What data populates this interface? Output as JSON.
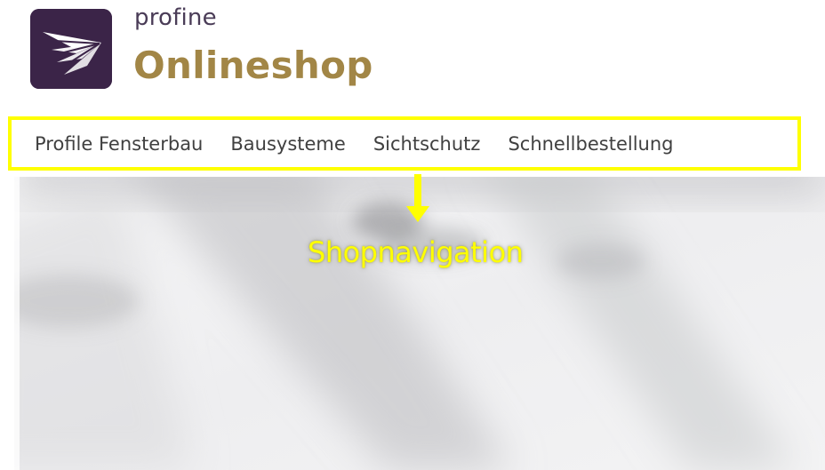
{
  "brand": {
    "logo_icon": "profine-arrow-icon",
    "brand_small": "profine",
    "brand_large": "Onlineshop",
    "colors": {
      "logo_background": "#3b2448",
      "brand_small_text": "#4a3c57",
      "brand_large_text": "#a28646"
    }
  },
  "nav": {
    "items": [
      {
        "label": "Profile Fensterbau"
      },
      {
        "label": "Bausysteme"
      },
      {
        "label": "Sichtschutz"
      },
      {
        "label": "Schnellbestellung"
      }
    ]
  },
  "annotation": {
    "label": "Shopnavigation",
    "highlight_color": "#ffff00",
    "arrow_icon": "arrow-down-icon"
  },
  "hero": {
    "image": "blurred-gray-background-image"
  }
}
